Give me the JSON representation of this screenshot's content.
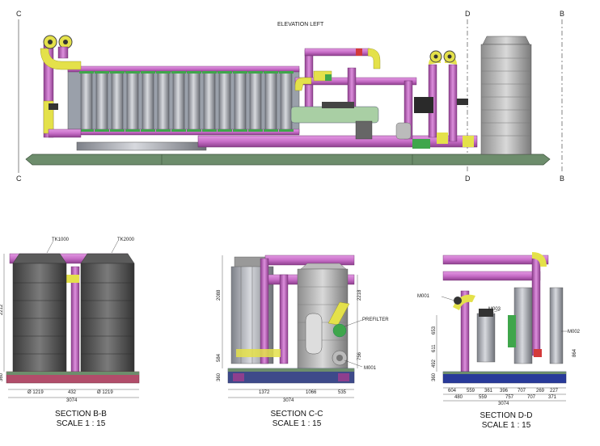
{
  "elevation": {
    "title": "ELEVATION LEFT",
    "markers": {
      "c_top": "C",
      "c_bottom": "C",
      "d_top": "D",
      "d_bottom": "D",
      "b_top": "B",
      "b_bottom": "B"
    }
  },
  "section_bb": {
    "title": "SECTION B-B",
    "scale": "SCALE 1 : 15",
    "tags": [
      "TK1000",
      "TK2000"
    ],
    "dims": {
      "overall": "3074",
      "d1": "Ø 1219",
      "d2": "432",
      "d3": "Ø 1219",
      "side": "2212",
      "base": "360"
    }
  },
  "section_cc": {
    "title": "SECTION C-C",
    "scale": "SCALE 1 : 15",
    "tags": [
      "PREFILTER",
      "M001"
    ],
    "dims": {
      "overall": "3074",
      "d1": "1372",
      "d2": "1066",
      "d3": "535",
      "h1": "2088",
      "h2": "2218",
      "h3": "756",
      "h4": "584",
      "base": "360"
    }
  },
  "section_dd": {
    "title": "SECTION D-D",
    "scale": "SCALE 1 : 15",
    "tags": [
      "M001",
      "M003",
      "M002"
    ],
    "dims": {
      "overall": "3074",
      "row1": [
        "604",
        "559",
        "361",
        "396",
        "707",
        "269",
        "227"
      ],
      "row2": [
        "480",
        "559",
        "757",
        "707",
        "371"
      ],
      "h1": "653",
      "h2": "611",
      "h3": "492",
      "h4": "864",
      "base": "360"
    }
  },
  "colors": {
    "pipe": "#c86ec8",
    "pipe_dark": "#8e3f8e",
    "accent_yellow": "#e4e14a",
    "steel": "#9a9ca2",
    "base": "#6d8d6c",
    "tank": "#8a8a8a",
    "dark_tank": "#5b5b5b",
    "flange_green": "#3fa64b",
    "red": "#d33a3a",
    "blue": "#283a9a"
  }
}
